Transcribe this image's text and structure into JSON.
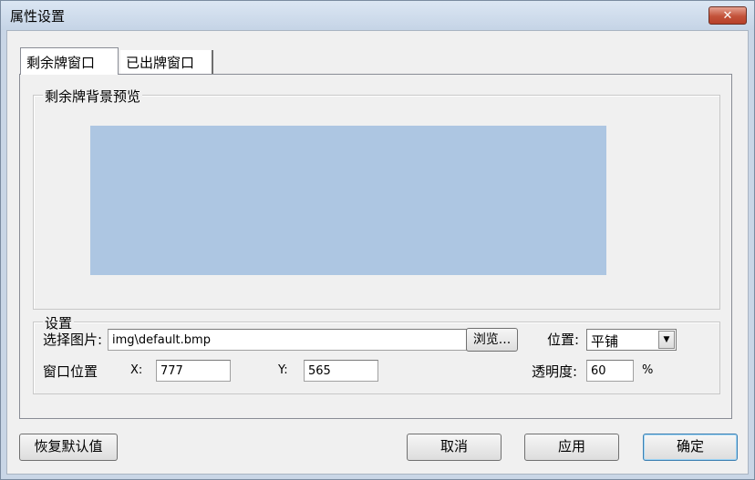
{
  "window": {
    "title": "属性设置",
    "close_label": "✕"
  },
  "tabs": [
    {
      "label": "剩余牌窗口",
      "active": true
    },
    {
      "label": "已出牌窗口",
      "active": false
    }
  ],
  "preview": {
    "group_label": "剩余牌背景预览",
    "background_color": "#adc6e2"
  },
  "settings": {
    "group_label": "设置",
    "image_label": "选择图片:",
    "image_value": "img\\default.bmp",
    "browse_label": "浏览...",
    "position_label": "位置:",
    "position_value": "平铺",
    "window_position_label": "窗口位置",
    "x_label": "X:",
    "x_value": "777",
    "y_label": "Y:",
    "y_value": "565",
    "opacity_label": "透明度:",
    "opacity_value": "60",
    "opacity_unit": "%"
  },
  "footer": {
    "restore_label": "恢复默认值",
    "cancel_label": "取消",
    "apply_label": "应用",
    "ok_label": "确定"
  }
}
